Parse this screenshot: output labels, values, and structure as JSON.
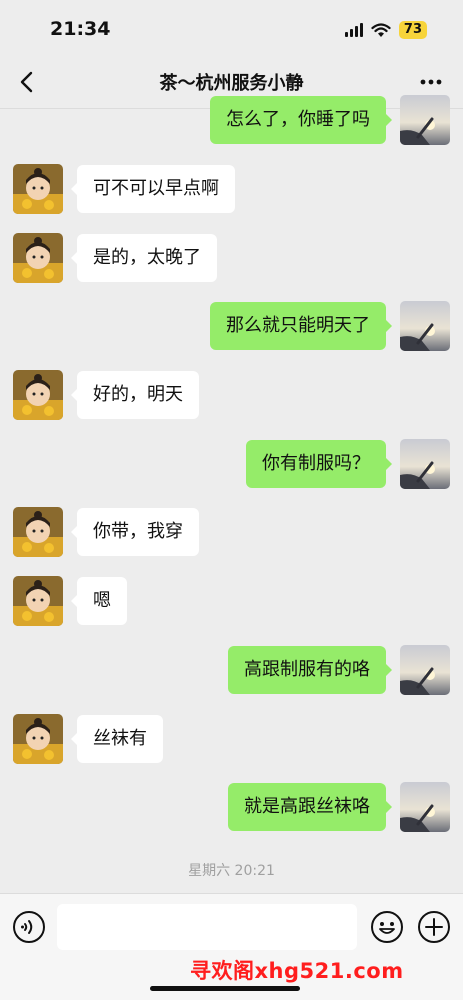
{
  "status_bar": {
    "time": "21:34",
    "battery": "73"
  },
  "nav": {
    "title": "茶～杭州服务小静",
    "back_icon": "chevron-left-icon",
    "more_icon": "ellipsis-icon"
  },
  "messages": [
    {
      "side": "right",
      "text": "怎么了，你睡了吗"
    },
    {
      "side": "left",
      "text": "可不可以早点啊"
    },
    {
      "side": "left",
      "text": "是的，太晚了"
    },
    {
      "side": "right",
      "text": "那么就只能明天了"
    },
    {
      "side": "left",
      "text": "好的，明天"
    },
    {
      "side": "right",
      "text": "你有制服吗？"
    },
    {
      "side": "left",
      "text": "你带，我穿"
    },
    {
      "side": "left",
      "text": "嗯"
    },
    {
      "side": "right",
      "text": "高跟制服有的咯"
    },
    {
      "side": "left",
      "text": "丝袜有"
    },
    {
      "side": "right",
      "text": "就是高跟丝袜咯"
    }
  ],
  "timestamp": "星期六 20:21",
  "input": {
    "placeholder": "",
    "value": ""
  },
  "watermark": "寻欢阁xhg521.com",
  "colors": {
    "background": "#ededed",
    "sent_bubble": "#95ec69",
    "received_bubble": "#ffffff",
    "battery": "#f7d43a",
    "watermark": "#ff1e1e"
  }
}
